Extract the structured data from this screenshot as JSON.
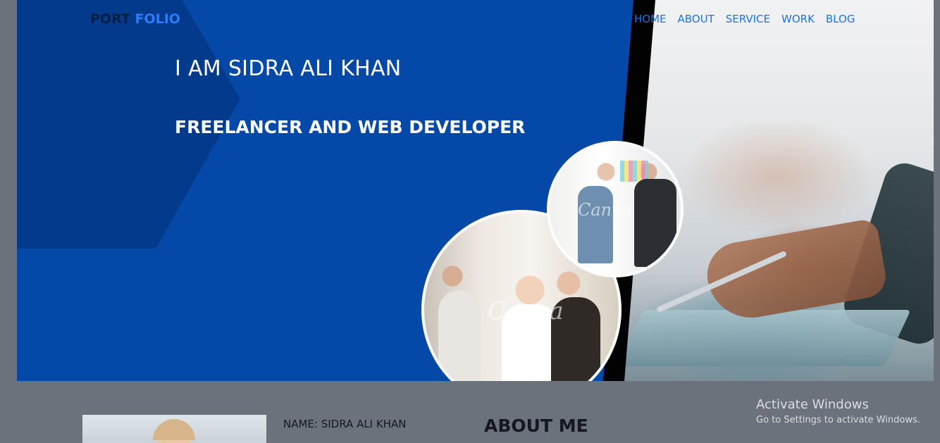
{
  "nav": {
    "logo_part1": "PORT",
    "logo_part2": "FOLIO",
    "items": [
      "HOME",
      "ABOUT",
      "SERVICE",
      "WORK",
      "BLOG"
    ]
  },
  "hero": {
    "title": "I AM SIDRA ALI KHAN",
    "subtitle": "FREELANCER AND WEB DEVELOPER",
    "watermark": "Canva"
  },
  "about": {
    "name_line": "NAME: SIDRA ALI KHAN",
    "heading": "ABOUT ME"
  },
  "system": {
    "activate_title": "Activate Windows",
    "activate_sub": "Go to Settings to activate Windows."
  },
  "colors": {
    "hero_blue": "#0448a8",
    "hex_dark": "#043a8b",
    "nav_link": "#1a73e8",
    "logo_accent": "#2e7bff",
    "page_bg": "#6c727c"
  }
}
